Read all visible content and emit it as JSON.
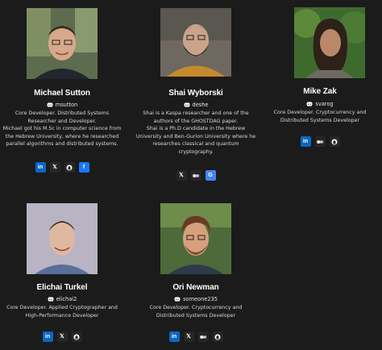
{
  "team": [
    {
      "name": "Michael Sutton",
      "handle": "msutton",
      "desc": [
        "Core Developer. Distributed Systems",
        "Researcher and Developer.",
        "Michael got his M.Sc in computer science from",
        "the Hebrew University, where he researched",
        "parallel algorithms and distributed systems."
      ],
      "socials": [
        "linkedin-icon",
        "x-icon",
        "github-icon",
        "facebook-icon"
      ]
    },
    {
      "name": "Shai Wyborski",
      "handle": "deshe",
      "desc": [
        "Shai is a Kaspa researcher and one of the",
        "authors of the GHOSTDAG paper.",
        "Shai is a Ph.D candidate in the Hebrew",
        "University and Ben-Gurion University where he",
        "researches classical and quantum",
        "cryptography."
      ],
      "socials": [
        "x-icon",
        "medium-icon",
        "google-icon"
      ]
    },
    {
      "name": "Mike Zak",
      "handle": "svarog",
      "desc": [
        "Core Developer. Cryptocurrency and",
        "Distributed Systems Developer"
      ],
      "socials": [
        "linkedin-icon",
        "medium-icon",
        "github-icon"
      ]
    },
    {
      "name": "Elichai Turkel",
      "handle": "elichai2",
      "desc": [
        "Core Developer. Applied Cryptographer and",
        "High-Performance Developer"
      ],
      "socials": [
        "linkedin-icon",
        "x-icon",
        "github-icon"
      ]
    },
    {
      "name": "Ori Newman",
      "handle": "someone235",
      "desc": [
        "Core Developer. Cryptocurrency and",
        "Distributed Systems Developer"
      ],
      "socials": [
        "linkedin-icon",
        "x-icon",
        "medium-icon",
        "github-icon"
      ]
    }
  ],
  "colors": {
    "background": "#1b1b1b",
    "linkedin": "#0a66c2",
    "facebook": "#1877f2",
    "google": "#4285f4"
  }
}
